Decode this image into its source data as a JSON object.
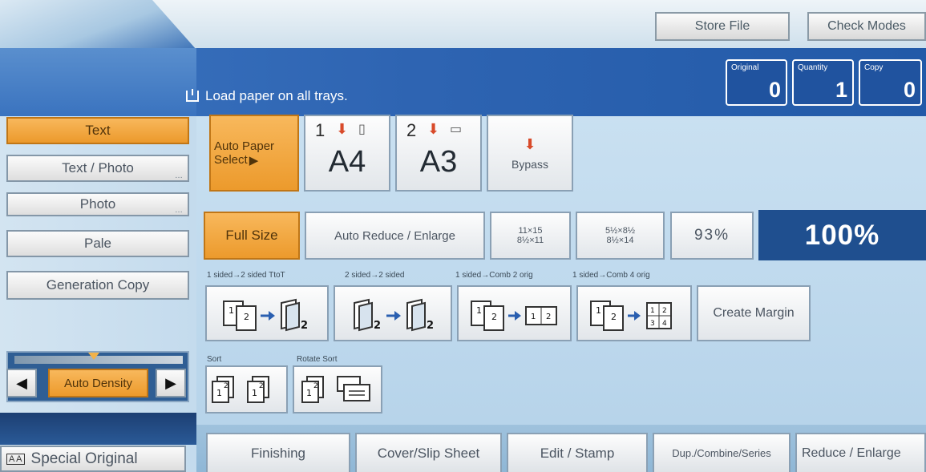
{
  "header": {
    "store_file": "Store File",
    "check_modes": "Check Modes"
  },
  "status": {
    "message": "Load paper on all trays.",
    "original_label": "Original",
    "original_value": "0",
    "quantity_label": "Quantity",
    "quantity_value": "1",
    "copy_label": "Copy",
    "copy_value": "0"
  },
  "original_modes": [
    {
      "label": "Text",
      "selected": true
    },
    {
      "label": "Text / Photo",
      "selected": false
    },
    {
      "label": "Photo",
      "selected": false
    },
    {
      "label": "Pale",
      "selected": false
    },
    {
      "label": "Generation Copy",
      "selected": false
    }
  ],
  "density": {
    "label": "Auto Density"
  },
  "special_original": "Special Original",
  "paper": {
    "auto_label_line1": "Auto Paper",
    "auto_label_line2": "Select",
    "trays": [
      {
        "number": "1",
        "size": "A4"
      },
      {
        "number": "2",
        "size": "A3"
      }
    ],
    "bypass": "Bypass"
  },
  "reduce": {
    "full_size": "Full Size",
    "auto_reduce": "Auto Reduce / Enlarge",
    "preset1_top": "11×15",
    "preset1_bottom": "8½×11",
    "preset2_top": "5½×8½",
    "preset2_bottom": "8½×14",
    "preset3": "93%",
    "current": "100%"
  },
  "duplex": {
    "cap1": "1 sided→2 sided TtoT",
    "cap2": "2 sided→2 sided",
    "cap3": "1 sided→Comb 2 orig",
    "cap4": "1 sided→Comb 4 orig",
    "create_margin": "Create Margin"
  },
  "sorting": {
    "sort": "Sort",
    "rotate_sort": "Rotate Sort"
  },
  "tabs": [
    "Finishing",
    "Cover/Slip Sheet",
    "Edit / Stamp",
    "Dup./Combine/Series",
    "Reduce / Enlarge"
  ]
}
